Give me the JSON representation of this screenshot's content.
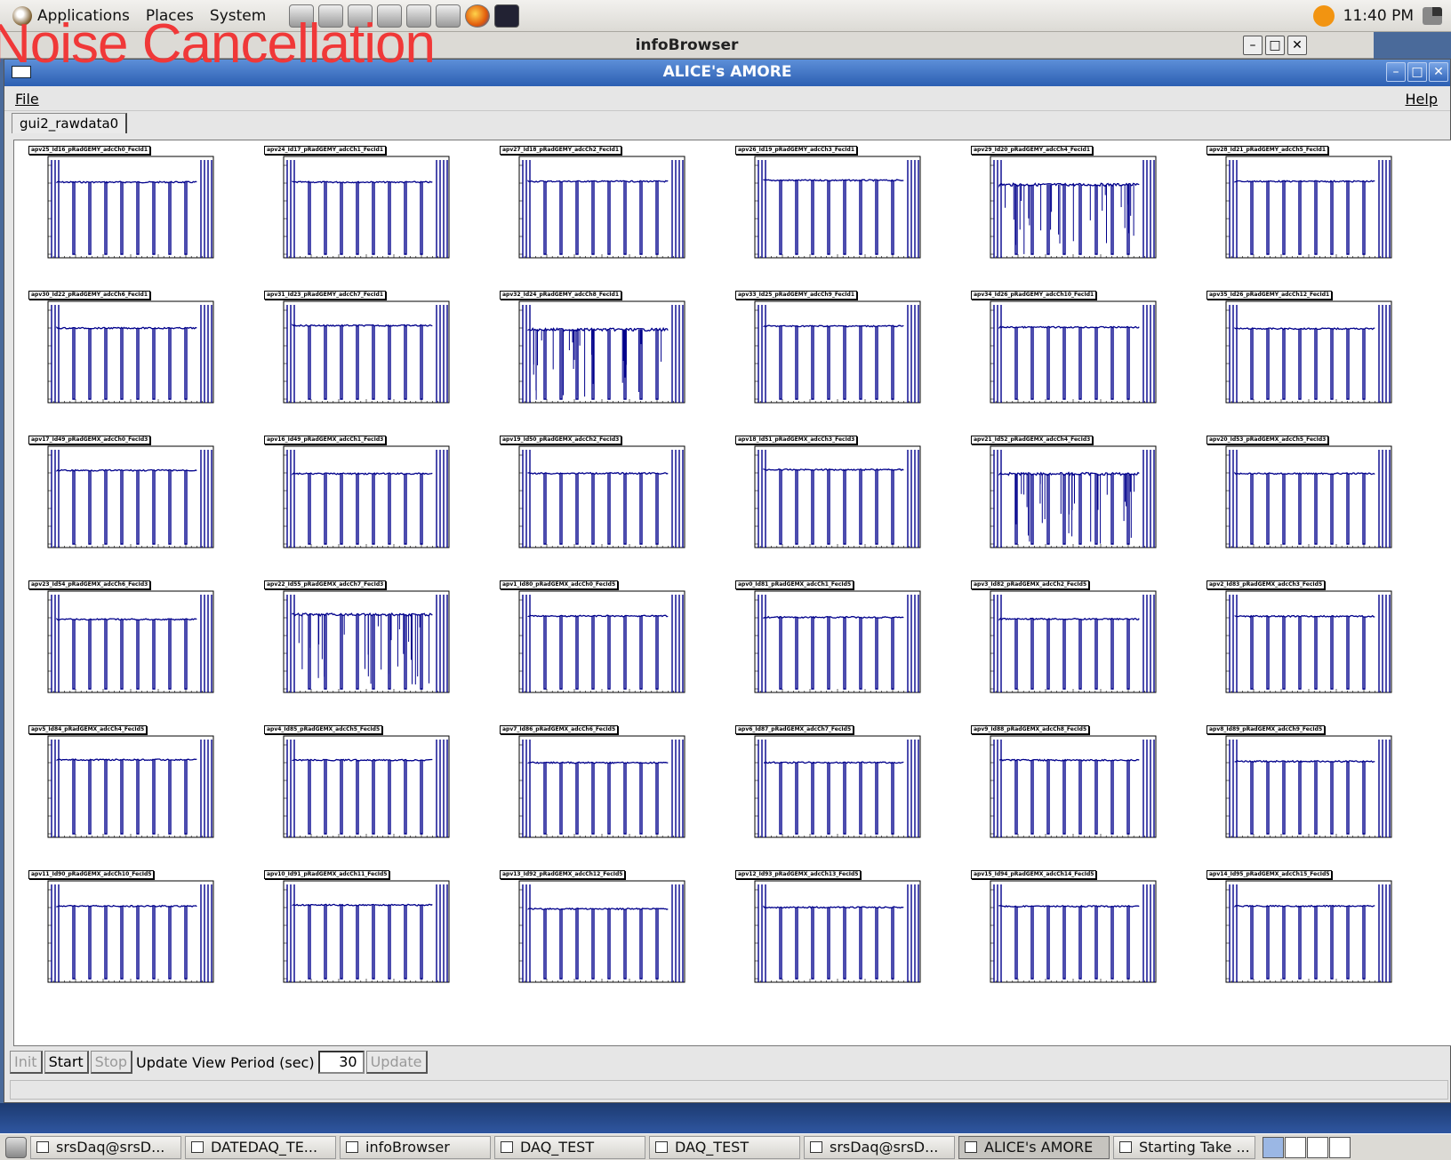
{
  "overlay": {
    "title": "Noise Cancellation"
  },
  "top_panel": {
    "menus": [
      "Applications",
      "Places",
      "System"
    ],
    "launchers": [
      "camera-icon",
      "network-icon",
      "editor-icon",
      "search-icon",
      "monitor-icon",
      "network-tools-icon",
      "firefox-icon",
      "terminal-icon"
    ],
    "clock": "11:40 PM"
  },
  "info_browser": {
    "title": "infoBrowser"
  },
  "window": {
    "title": "ALICE's AMORE",
    "menu_file": "File",
    "menu_help": "Help",
    "tab": "gui2_rawdata0"
  },
  "plots": [
    {
      "title": "apv25_Id16_pRadGEMY_adcCh0_FecId1",
      "spiky": false
    },
    {
      "title": "apv24_Id17_pRadGEMY_adcCh1_FecId1",
      "spiky": false
    },
    {
      "title": "apv27_Id18_pRadGEMY_adcCh2_FecId1",
      "spiky": false
    },
    {
      "title": "apv26_Id19_pRadGEMY_adcCh3_FecId1",
      "spiky": false
    },
    {
      "title": "apv29_Id20_pRadGEMY_adcCh4_FecId1",
      "spiky": true
    },
    {
      "title": "apv28_Id21_pRadGEMY_adcCh5_FecId1",
      "spiky": false
    },
    {
      "title": "apv30_Id22_pRadGEMY_adcCh6_FecId1",
      "spiky": false
    },
    {
      "title": "apv31_Id23_pRadGEMY_adcCh7_FecId1",
      "spiky": false
    },
    {
      "title": "apv32_Id24_pRadGEMY_adcCh8_FecId1",
      "spiky": true
    },
    {
      "title": "apv33_Id25_pRadGEMY_adcCh9_FecId1",
      "spiky": false
    },
    {
      "title": "apv34_Id26_pRadGEMY_adcCh10_FecId1",
      "spiky": false
    },
    {
      "title": "apv35_Id26_pRadGEMY_adcCh12_FecId1",
      "spiky": false
    },
    {
      "title": "apv17_Id49_pRadGEMX_adcCh0_FecId3",
      "spiky": false
    },
    {
      "title": "apv16_Id49_pRadGEMX_adcCh1_FecId3",
      "spiky": false
    },
    {
      "title": "apv19_Id50_pRadGEMX_adcCh2_FecId3",
      "spiky": false
    },
    {
      "title": "apv18_Id51_pRadGEMX_adcCh3_FecId3",
      "spiky": false
    },
    {
      "title": "apv21_Id52_pRadGEMX_adcCh4_FecId3",
      "spiky": true
    },
    {
      "title": "apv20_Id53_pRadGEMX_adcCh5_FecId3",
      "spiky": false
    },
    {
      "title": "apv23_Id54_pRadGEMX_adcCh6_FecId3",
      "spiky": false
    },
    {
      "title": "apv22_Id55_pRadGEMX_adcCh7_FecId3",
      "spiky": true
    },
    {
      "title": "apv1_Id80_pRadGEMX_adcCh0_FecId5",
      "spiky": false
    },
    {
      "title": "apv0_Id81_pRadGEMX_adcCh1_FecId5",
      "spiky": false
    },
    {
      "title": "apv3_Id82_pRadGEMX_adcCh2_FecId5",
      "spiky": false
    },
    {
      "title": "apv2_Id83_pRadGEMX_adcCh3_FecId5",
      "spiky": false
    },
    {
      "title": "apv5_Id84_pRadGEMX_adcCh4_FecId5",
      "spiky": false
    },
    {
      "title": "apv4_Id85_pRadGEMX_adcCh5_FecId5",
      "spiky": false
    },
    {
      "title": "apv7_Id86_pRadGEMX_adcCh6_FecId5",
      "spiky": false
    },
    {
      "title": "apv6_Id87_pRadGEMX_adcCh7_FecId5",
      "spiky": false
    },
    {
      "title": "apv9_Id88_pRadGEMX_adcCh8_FecId5",
      "spiky": false
    },
    {
      "title": "apv8_Id89_pRadGEMX_adcCh9_FecId5",
      "spiky": false
    },
    {
      "title": "apv11_Id90_pRadGEMX_adcCh10_FecId5",
      "spiky": false
    },
    {
      "title": "apv10_Id91_pRadGEMX_adcCh11_FecId5",
      "spiky": false
    },
    {
      "title": "apv13_Id92_pRadGEMX_adcCh12_FecId5",
      "spiky": false
    },
    {
      "title": "apv12_Id93_pRadGEMX_adcCh13_FecId5",
      "spiky": false
    },
    {
      "title": "apv15_Id94_pRadGEMX_adcCh14_FecId5",
      "spiky": false
    },
    {
      "title": "apv14_Id95_pRadGEMX_adcCh15_FecId5",
      "spiky": false
    }
  ],
  "controls": {
    "init": "Init",
    "start": "Start",
    "stop": "Stop",
    "period_label": "Update View Period (sec)",
    "period_value": "30",
    "update": "Update"
  },
  "taskbar": [
    {
      "label": "srsDaq@srsD...",
      "active": false
    },
    {
      "label": "DATEDAQ_TE...",
      "active": false
    },
    {
      "label": "infoBrowser",
      "active": false
    },
    {
      "label": "DAQ_TEST",
      "active": false
    },
    {
      "label": "DAQ_TEST",
      "active": false
    },
    {
      "label": "srsDaq@srsD...",
      "active": false
    },
    {
      "label": "ALICE's AMORE",
      "active": true
    },
    {
      "label": "Starting Take ...",
      "active": false
    }
  ],
  "colors": {
    "trace": "#00008b",
    "titlebar": "#3467bb",
    "overlay": "#f03838"
  }
}
